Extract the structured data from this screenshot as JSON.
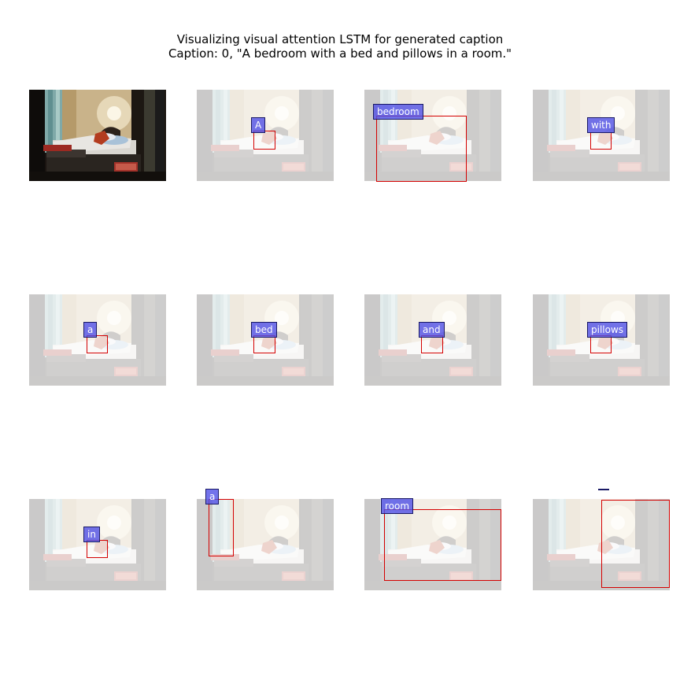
{
  "figure": {
    "title_line1": "Visualizing visual attention LSTM for generated caption",
    "title_line2": "Caption: 0, \"A bedroom with a bed and pillows in a room.\""
  },
  "panels": [
    {
      "word": "",
      "kind": "original"
    },
    {
      "word": "A"
    },
    {
      "word": "bedroom"
    },
    {
      "word": "with"
    },
    {
      "word": "a"
    },
    {
      "word": "bed"
    },
    {
      "word": "and"
    },
    {
      "word": "pillows"
    },
    {
      "word": "in"
    },
    {
      "word": "a"
    },
    {
      "word": "room"
    },
    {
      "word": ""
    }
  ],
  "colors": {
    "box_border": "#d40000",
    "label_fill": "#5050e6",
    "label_border": "#1a1a66"
  }
}
